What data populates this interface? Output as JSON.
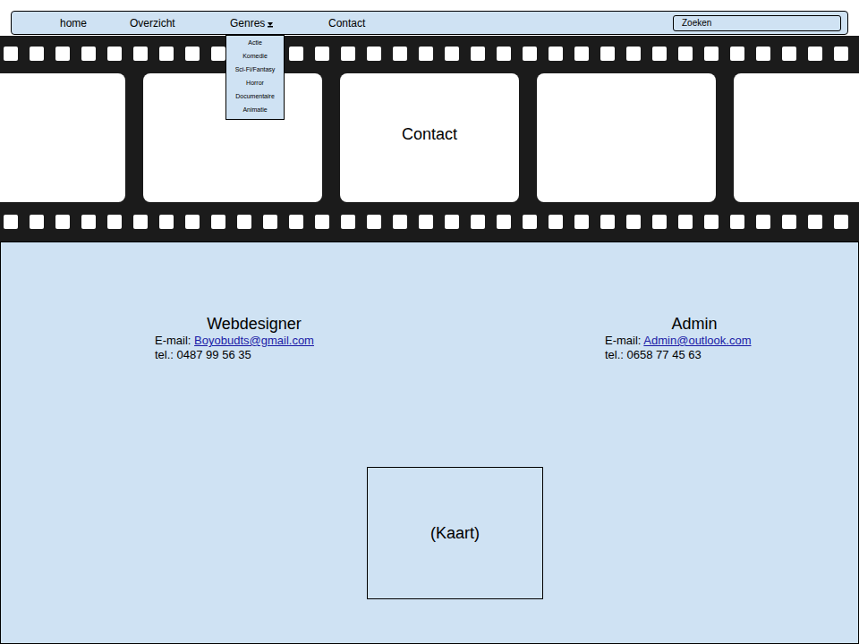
{
  "nav": {
    "items": [
      {
        "label": "home",
        "dropdown": false,
        "expanded": false
      },
      {
        "label": "Overzicht",
        "dropdown": false,
        "expanded": false
      },
      {
        "label": "Genres",
        "dropdown": true,
        "expanded": true
      },
      {
        "label": "Contact",
        "dropdown": false,
        "expanded": false
      }
    ]
  },
  "genres_menu": {
    "items": [
      "Actie",
      "Komedie",
      "Sci-Fi/Fantasy",
      "Horror",
      "Documentaire",
      "Animatie"
    ]
  },
  "search": {
    "placeholder": "Zoeken"
  },
  "banner": {
    "title": "Contact"
  },
  "contacts": [
    {
      "role": "Webdesigner",
      "email_label": "E-mail:",
      "email": "Boyobudts@gmail.com",
      "phone": "tel.: 0487 99 56 35"
    },
    {
      "role": "Admin",
      "email_label": "E-mail:",
      "email": "Admin@outlook.com",
      "phone": "tel.: 0658 77 45 63"
    }
  ],
  "map": {
    "label": "(Kaart)"
  }
}
